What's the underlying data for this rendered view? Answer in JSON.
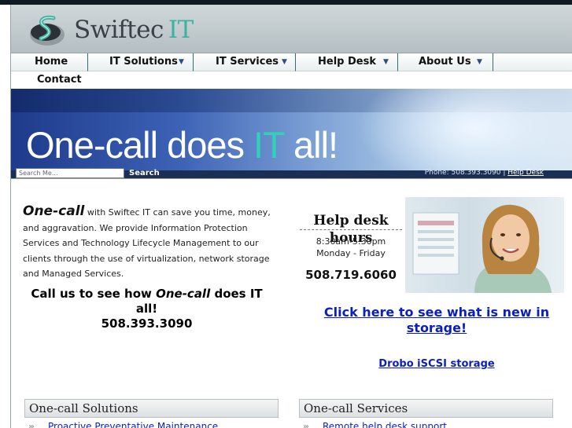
{
  "brand": {
    "logo_name": "Swiftec",
    "logo_suffix": "IT",
    "accent_color": "#3fb1a0"
  },
  "nav": {
    "items": [
      {
        "label": "Home"
      },
      {
        "label": "IT Solutions"
      },
      {
        "label": "IT Services"
      },
      {
        "label": "Help Desk"
      },
      {
        "label": "About Us"
      },
      {
        "label": "Contact"
      }
    ]
  },
  "banner": {
    "tagline_a": "One-call does ",
    "tagline_b": "IT",
    "tagline_c": " all!",
    "search_placeholder": "Search Me...",
    "search_button": "Search",
    "phone": "Phone: 508.393.3090 |",
    "help_desk_link": "Help Desk"
  },
  "intro": {
    "brand_word": "One-call",
    "text": " with Swiftec IT can save you time, money, and aggravation. We provide Information Protection Services and Technology Lifecycle Management to our clients through the use of virtualization, network storage and Managed Services."
  },
  "callout": {
    "line1a": "Call us to see how ",
    "line1b": "One-call",
    "line1c": " does IT all!",
    "phone": "508.393.3090"
  },
  "help_desk": {
    "title": "Help desk hours",
    "hours": "8:30am-5:30pm",
    "days": "Monday - Friday",
    "phone": "508.719.6060"
  },
  "promo": {
    "link": "Click here to see what is new in storage!",
    "sublink": "Drobo iSCSI storage"
  },
  "sections": {
    "solutions": {
      "title": "One-call Solutions",
      "first_item": "Proactive Preventative Maintenance"
    },
    "services": {
      "title": "One-call Services",
      "first_item": "Remote help desk support"
    }
  }
}
